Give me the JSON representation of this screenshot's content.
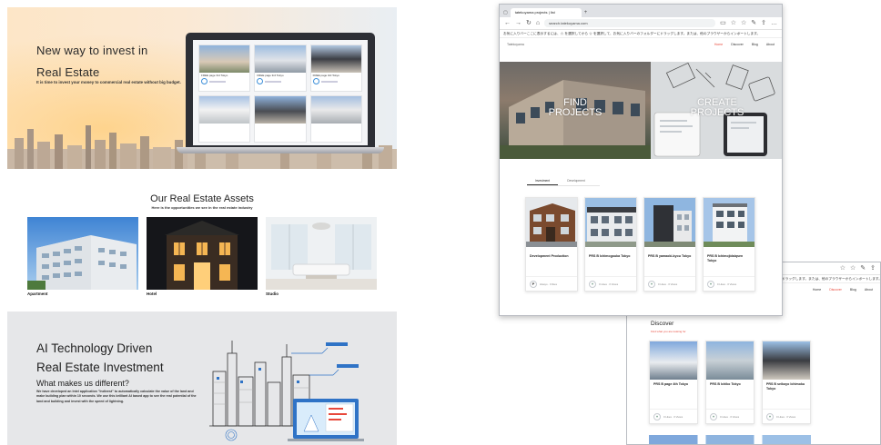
{
  "left_panel": {
    "hero": {
      "title_line1": "New way to invest in",
      "title_line2": "Real Estate",
      "description": "It is time to invest your money to commercial real estate without big budget.",
      "laptop_cards": [
        {
          "title": "FREE page 3rd Tokyo",
          "status": "Sold Out / Projects"
        },
        {
          "title": "FREE page 3rd Tokyo",
          "status": "Sold Out / Projects"
        },
        {
          "title": "FREE page 3rd Tokyo",
          "status": "Sold Out / Projects"
        },
        {
          "title": "",
          "status": ""
        },
        {
          "title": "",
          "status": ""
        },
        {
          "title": "",
          "status": ""
        }
      ]
    },
    "assets": {
      "heading": "Our Real Estate Assets",
      "subheading": "Here is the opportunities we see in the real estate industry",
      "items": [
        {
          "label": "Apartment"
        },
        {
          "label": "Hotel"
        },
        {
          "label": "Studio"
        }
      ]
    },
    "ai_section": {
      "title_line1": "AI Technology Driven",
      "title_line2": "Real Estate Investment",
      "subtitle": "What makes us different?",
      "body": "We have developed an Intel application \"Indivest\" to automatically calculate the value of the land and make building plan within 10 seconds. We use this brilliant AI based app to see the real potential of the land and building and invest with the speed of lightning."
    }
  },
  "browser_front": {
    "tab_title": "tatekoyama projects | list",
    "url": "search.tatekoyama.com",
    "bookmark_bar": "お気に入りバーここに表示するには、☆ を選択してから ☆ を選択して、お気に入りバーのフォルダーにドラッグします。または、他のブラウザーからインポートします。",
    "site_logo": "Tatekoyama",
    "nav": [
      "Home",
      "Discover",
      "Blog",
      "About"
    ],
    "active_nav": "Home",
    "hero_left": "FIND\nPROJECTS",
    "hero_right": "CREATE\nPROJECTS",
    "tabs": [
      "Investment",
      "Development"
    ],
    "projects": [
      {
        "title": "Development Production",
        "meta": "Hisayo · 0 likes"
      },
      {
        "title": "PRS B Ichimogouka Tokyo",
        "meta": "0 Likes · 0 Views"
      },
      {
        "title": "PRS B yamaoki-kyou Tokyo",
        "meta": "0 Likes · 0 Views"
      },
      {
        "title": "PRS B Ichimojidaiqsen Tokyo",
        "meta": "0 Likes · 0 Views"
      }
    ]
  },
  "browser_back": {
    "bookmark_bar": "ドラッグします。または、他のブラウザーからインポートします。",
    "nav": [
      "Home",
      "Discover",
      "Blog",
      "About"
    ],
    "active_nav": "Discover",
    "heading": "Discover",
    "subheading": "Find what you are looking for",
    "projects": [
      {
        "title": "PRS B page 4th Tokyo",
        "meta": "0 Likes · 0 Views"
      },
      {
        "title": "PRS B Ichiko Tokyo",
        "meta": "0 Likes · 0 Views"
      },
      {
        "title": "PRS B seikoyo Ichimoku Tokyo",
        "meta": "0 Likes · 0 Views"
      }
    ]
  },
  "colors": {
    "accent_red": "#e8483b",
    "laptop_frame": "#2d2f35",
    "ai_bg": "#e6e7e9",
    "ai_blue": "#2f73c6"
  }
}
